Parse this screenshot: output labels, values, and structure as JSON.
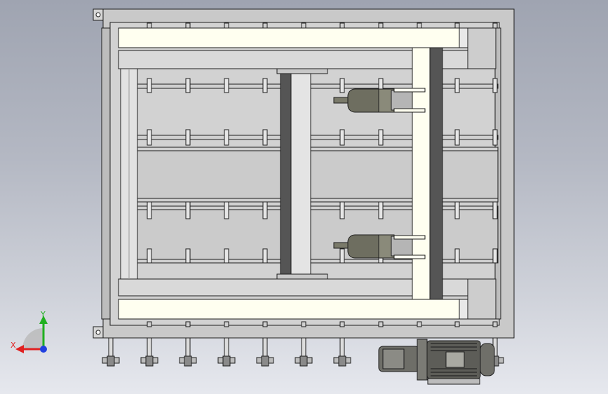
{
  "viewport": {
    "background_top": "#9fa4b1",
    "background_bottom": "#e6e8ee"
  },
  "model": {
    "frame_color": "#c9c9c9",
    "rail_color": "#fffff0",
    "dark_color": "#555555",
    "edge_color": "#1e1e1e",
    "cylinders": 2,
    "rollers_per_row": 10,
    "sprockets": 11
  },
  "triad": {
    "x_label": "X",
    "y_label": "Y",
    "x_color": "#e02020",
    "y_color": "#20b020",
    "z_color": "#2040e0"
  }
}
